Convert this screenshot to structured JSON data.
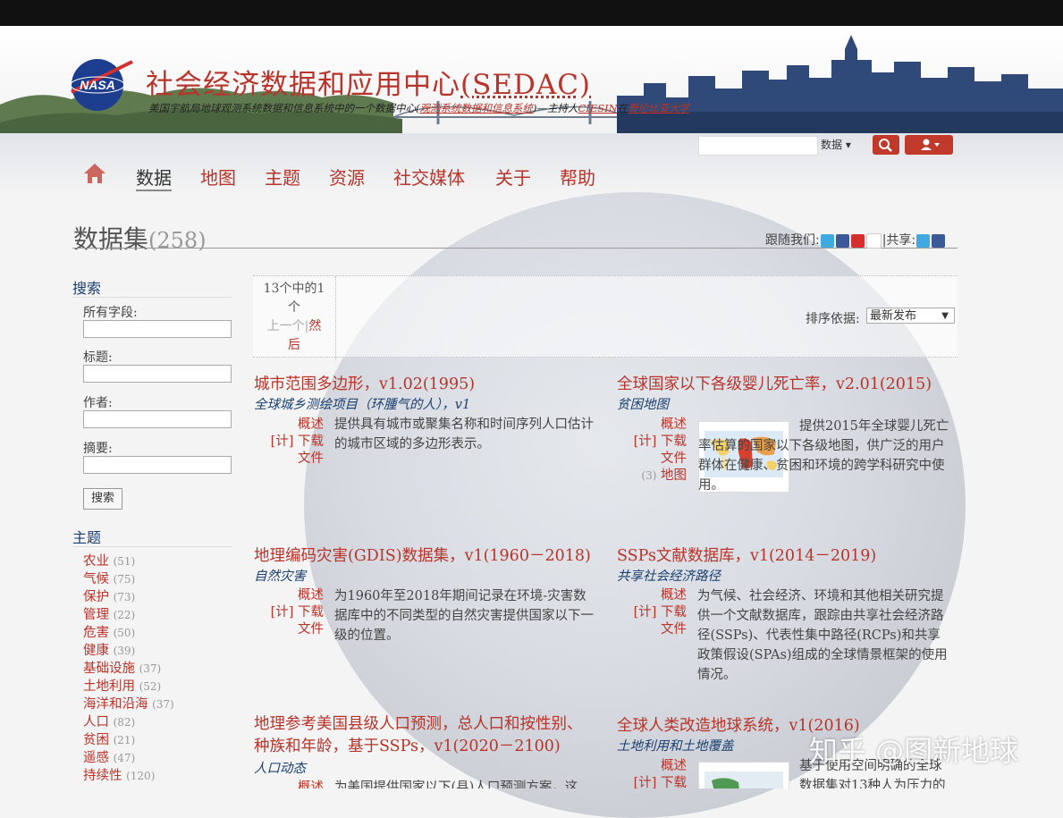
{
  "header": {
    "title": "社会经济数据和应用中心",
    "title_abbr": "(SEDAC)",
    "subtitle_pre": "美国宇航局地球观测系统数据和信息系统中的一个数据中心(",
    "subtitle_link": "观测系统数据和信息系统",
    "subtitle_mid": ")—主持人",
    "subtitle_host": "CIESIN",
    "subtitle_at": "在",
    "subtitle_univ": "哥伦比亚大学"
  },
  "search": {
    "scope": "数据 ▾"
  },
  "nav": [
    "数据",
    "地图",
    "主题",
    "资源",
    "社交媒体",
    "关于",
    "帮助"
  ],
  "page": {
    "title": "数据集",
    "count": "(258)",
    "follow": "跟随我们:",
    "share": "|共享:"
  },
  "sidebar": {
    "search_heading": "搜索",
    "fields": [
      "所有字段:",
      "标题:",
      "作者:",
      "摘要:"
    ],
    "search_button": "搜索",
    "topics_heading": "主题",
    "topics": [
      {
        "name": "农业",
        "count": "(51)"
      },
      {
        "name": "气候",
        "count": "(75)"
      },
      {
        "name": "保护",
        "count": "(73)"
      },
      {
        "name": "管理",
        "count": "(22)"
      },
      {
        "name": "危害",
        "count": "(50)"
      },
      {
        "name": "健康",
        "count": "(39)"
      },
      {
        "name": "基础设施",
        "count": "(37)"
      },
      {
        "name": "土地利用",
        "count": "(52)"
      },
      {
        "name": "海洋和沿海",
        "count": "(37)"
      },
      {
        "name": "人口",
        "count": "(82)"
      },
      {
        "name": "贫困",
        "count": "(21)"
      },
      {
        "name": "遥感",
        "count": "(47)"
      },
      {
        "name": "持续性",
        "count": "(120)"
      }
    ]
  },
  "pager": {
    "line1": "13个中的1",
    "line2": "个",
    "prev": "上一个|",
    "next1": "然",
    "next2": "后",
    "sort_label": "排序依据:",
    "sort_value": "最新发布"
  },
  "datasets": [
    {
      "title": "城市范围多边形，v1.02(1995)",
      "subtitle": "全球城乡测绘项目（环腫气的人），v1",
      "overview": "概述",
      "download": "[计] 下载",
      "files": "文件",
      "maps": "",
      "map_count": "",
      "desc": "提供具有城市或聚集名称和时间序列人口估计的城市区域的多边形表示。"
    },
    {
      "title": "全球国家以下各级婴儿死亡率，v2.01(2015)",
      "subtitle": "贫困地图",
      "overview": "概述",
      "download": "[计] 下载",
      "files": "文件",
      "maps": "地图",
      "map_count": "(3)",
      "desc": "提供2015年全球婴儿死亡率估算的国家以下各级地图，供广泛的用户群体在健康、贫困和环境的跨学科研究中使用。"
    },
    {
      "title": "地理编码灾害(GDIS)数据集，v1(1960－2018)",
      "subtitle": "自然灾害",
      "overview": "概述",
      "download": "[计] 下载",
      "files": "文件",
      "maps": "",
      "map_count": "",
      "desc": "为1960年至2018年期间记录在环境-灾害数据库中的不同类型的自然灾害提供国家以下一级的位置。"
    },
    {
      "title": "SSPs文献数据库，v1(2014－2019)",
      "subtitle": "共享社会经济路径",
      "overview": "概述",
      "download": "[计] 下载",
      "files": "文件",
      "maps": "",
      "map_count": "",
      "desc": "为气候、社会经济、环境和其他相关研究提供一个文献数据库，跟踪由共享社会经济路径(SSPs)、代表性集中路径(RCPs)和共享政策假设(SPAs)组成的全球情景框架的使用情况。"
    },
    {
      "title": "地理参考美国县级人口预测，总人口和按性别、种族和年龄，基于SSPs，v1(2020－2100)",
      "subtitle": "人口动态",
      "overview": "概述",
      "download": "",
      "files": "",
      "maps": "",
      "map_count": "",
      "desc": "为美国提供国家以下(县)人口预测方案，这"
    },
    {
      "title": "全球人类改造地球系统，v1(2016)",
      "subtitle": "土地利用和土地覆盖",
      "overview": "概述",
      "download": "[计] 下载",
      "files": "",
      "maps": "",
      "map_count": "",
      "desc": "基于使用空间明确的全球数据集对13种人为压力的"
    }
  ],
  "watermark": "知乎 @图新地球",
  "colors": {
    "accent": "#b8342a",
    "link_blue": "#1a3f6e"
  }
}
